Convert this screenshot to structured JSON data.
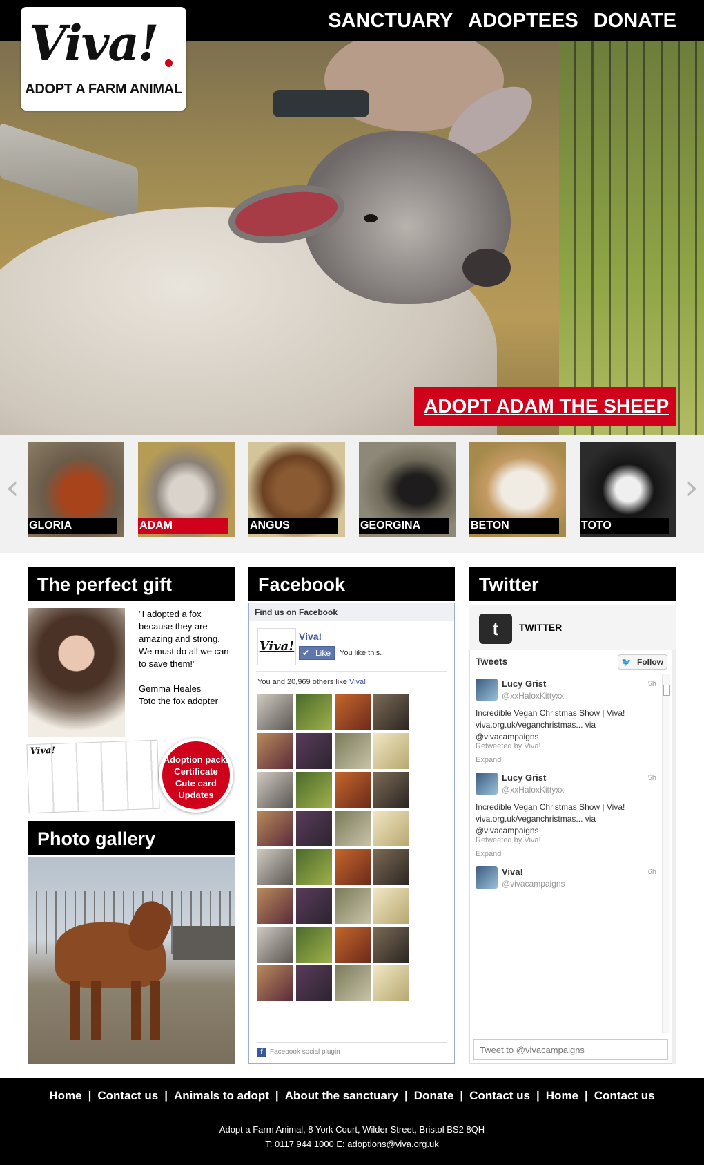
{
  "header": {
    "logo_text": "Viva!",
    "logo_tagline": "ADOPT A FARM ANIMAL",
    "nav": [
      "SANCTUARY",
      "ADOPTEES",
      "DONATE"
    ]
  },
  "hero": {
    "cta": "ADOPT ADAM THE SHEEP"
  },
  "carousel": {
    "items": [
      {
        "label": "GLORIA",
        "active": false
      },
      {
        "label": "ADAM",
        "active": true
      },
      {
        "label": "ANGUS",
        "active": false
      },
      {
        "label": "GEORGINA",
        "active": false
      },
      {
        "label": "BETON",
        "active": false
      },
      {
        "label": "TOTO",
        "active": false
      }
    ],
    "prev_icon": "chevron-left-icon",
    "next_icon": "chevron-right-icon"
  },
  "gift": {
    "title": "The perfect gift",
    "quote": "\"I adopted a fox because they are amazing and strong. We must do all we can to save them!\"",
    "author": "Gemma Heales",
    "author_role": "Toto the fox adopter",
    "pack_lines": [
      "Adoption pack:",
      "Certificate",
      "Cute card",
      "Updates"
    ]
  },
  "gallery": {
    "title": "Photo gallery"
  },
  "facebook": {
    "title": "Facebook",
    "find_us": "Find us on Facebook",
    "page_name": "Viva!",
    "like_button": "Like",
    "you_like": "You like this.",
    "count_text": "You and 20,969 others like",
    "count_link": "Viva!",
    "footer": "Facebook social plugin"
  },
  "twitter": {
    "title": "Twitter",
    "account_label": "TWITTER",
    "tweets_label": "Tweets",
    "follow_label": "Follow",
    "tweets": [
      {
        "name": "Lucy Grist",
        "handle": "@xxHaloxKittyxx",
        "time": "5h",
        "text_lines": [
          "Incredible Vegan Christmas Show | Viva!",
          "viva.org.uk/veganchristmas... via",
          "@vivacampaigns"
        ],
        "retweet": "Retweeted by Viva!",
        "expand": "Expand"
      },
      {
        "name": "Lucy Grist",
        "handle": "@xxHaloxKittyxx",
        "time": "5h",
        "text_lines": [
          "Incredible Vegan Christmas Show | Viva!",
          "viva.org.uk/veganchristmas... via",
          "@vivacampaigns"
        ],
        "retweet": "Retweeted by Viva!",
        "expand": "Expand"
      },
      {
        "name": "Viva!",
        "handle": "@vivacampaigns",
        "time": "6h",
        "text_lines": [],
        "retweet": "",
        "expand": ""
      }
    ],
    "input_placeholder": "Tweet to @vivacampaigns"
  },
  "footer": {
    "links": [
      "Home",
      "Contact us",
      "Animals to adopt",
      "About the sanctuary",
      "Donate",
      "Contact us",
      "Home",
      "Contact us"
    ],
    "address": "Adopt a Farm Animal, 8 York Court, Wilder Street, Bristol BS2 8QH",
    "contact": "T: 0117 944 1000 E: adoptions@viva.org.uk"
  },
  "colors": {
    "brand_red": "#d0021b",
    "black": "#000000",
    "facebook_blue": "#3b5998"
  }
}
